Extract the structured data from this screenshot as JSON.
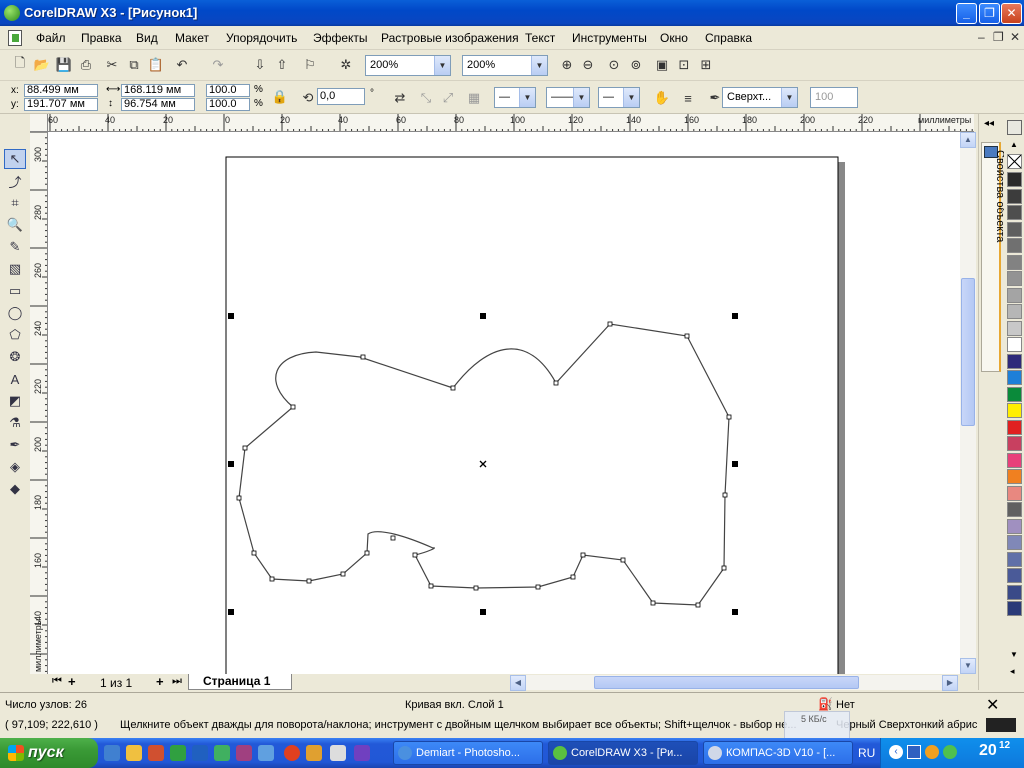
{
  "window": {
    "title": "CorelDRAW X3 - [Рисунок1]",
    "minimize": "_",
    "maximize": "❐",
    "close": "✕"
  },
  "menu": {
    "items": [
      "Файл",
      "Правка",
      "Вид",
      "Макет",
      "Упорядочить",
      "Эффекты",
      "Растровые изображения",
      "Текст",
      "Инструменты",
      "Окно",
      "Справка"
    ],
    "doc_controls": [
      "–",
      "❐",
      "✕"
    ]
  },
  "toolbar": {
    "zoom1": "200%",
    "zoom2": "200%"
  },
  "property_bar": {
    "x_label": "x:",
    "x_value": "88.499 мм",
    "y_label": "y:",
    "y_value": "191.707 мм",
    "width_value": "168.119 мм",
    "height_value": "96.754 мм",
    "scale_x": "100.0",
    "scale_y": "100.0",
    "percent": "%",
    "angle_value": "0,0",
    "degree": "°",
    "outline_width": "Сверхт...",
    "smoothness": "100"
  },
  "rulers": {
    "top_ticks": [
      "60",
      "40",
      "20",
      "0",
      "20",
      "40",
      "60",
      "80",
      "100",
      "120",
      "140",
      "160",
      "180",
      "200",
      "220"
    ],
    "top_unit": "миллиметры",
    "left_ticks": [
      "300",
      "280",
      "260",
      "240",
      "220",
      "200",
      "180",
      "160",
      "140"
    ],
    "left_unit": "миллиметры"
  },
  "docker": {
    "tab_label": "Свойства объекта"
  },
  "palette": {
    "colors": [
      "#2b2b2b",
      "#3c3c3c",
      "#4e4e4e",
      "#5f5f5f",
      "#707070",
      "#828282",
      "#939393",
      "#a4a4a4",
      "#b6b6b6",
      "#c8c8c8",
      "#ffffff",
      "#2e2a7a",
      "#1e7fd8",
      "#0a8a3a",
      "#ffee00",
      "#e02020",
      "#c84060",
      "#e8407a",
      "#f08020",
      "#e88880",
      "#606060",
      "#a090c0",
      "#8088b8",
      "#6070a8",
      "#4a5a98",
      "#3a4a88",
      "#2a3a78"
    ]
  },
  "pages": {
    "counter": "1 из 1",
    "tab": "Страница 1"
  },
  "status": {
    "nodes": "Число узлов: 26",
    "object_info": "Кривая вкл. Слой 1",
    "fill": "Нет",
    "coords": "( 97,109; 222,610 )",
    "hint": "Щелкните объект дважды для поворота/наклона; инструмент с двойным щелчком выбирает все объекты; Shift+щелчок - выбор не...",
    "outline": "Черный  Сверхтонкий абрис",
    "speed_overlay": "5 КБ/с"
  },
  "taskbar": {
    "start": "пуск",
    "tasks": [
      "Demiart - Photosho...",
      "CorelDRAW X3 - [Ри...",
      "КОМПАС-3D V10 - [..."
    ],
    "lang": "RU",
    "time": "20",
    "time_sup": "12"
  },
  "colors": {
    "titlebar": "#0a46c0",
    "canvas": "#ffffff",
    "accent": "#316ac5"
  }
}
